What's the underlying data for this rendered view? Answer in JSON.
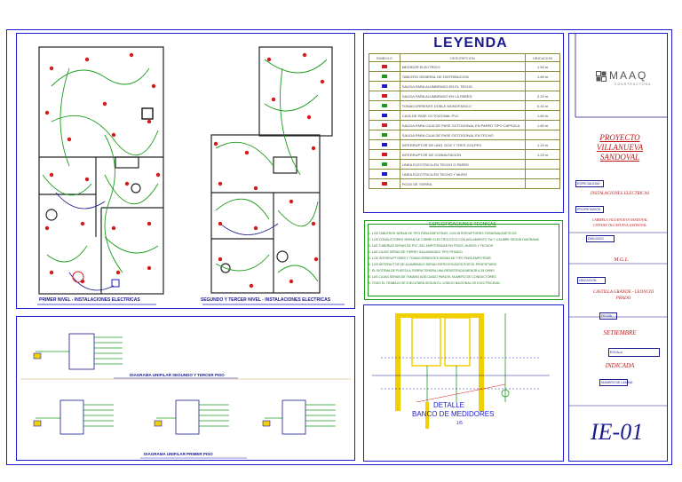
{
  "plans": {
    "first_floor_caption": "PRIMER NIVEL - INSTALACIONES ELECTRICAS",
    "upper_floors_caption": "SEGUNDO Y TERCER NIVEL - INSTALACIONES ELECTRICAS"
  },
  "diagrams": {
    "upper_caption": "DIAGRAMA UNIFILAR SEGUNDO Y TERCER PISO",
    "first_caption": "DIAGRAMA UNIFILAR PRIMER PISO"
  },
  "legend": {
    "title": "LEYENDA",
    "headers": [
      "SIMBOLO",
      "DESCRIPCION",
      "UBICACION"
    ],
    "rows": [
      {
        "desc": "MEDIDOR ELECTRICO",
        "loc": "1.50 m"
      },
      {
        "desc": "TABLERO GENERAL DE DISTRIBUCION",
        "loc": "1.80 m"
      },
      {
        "desc": "SALIDA PARA ALUMBRADO EN EL TECHO",
        "loc": ""
      },
      {
        "desc": "SALIDA PARA ALUMBRADO EN LA PARED",
        "loc": "2.20 m"
      },
      {
        "desc": "TOMACORRIENTE DOBLE MONOFASICO",
        "loc": "0.40 m"
      },
      {
        "desc": "CAJA DE PASE OCTOGONAL PVC",
        "loc": "1.80 m"
      },
      {
        "desc": "SALIDA PARA CAJA DE PASE OCTOGONAL EN PARED TIPO CAPSULA",
        "loc": "1.80 m"
      },
      {
        "desc": "SALIDA PARA CAJA DE PASE OCTOGONAL EN TECHO",
        "loc": ""
      },
      {
        "desc": "INTERRUPTOR DE UNO, DOS Y TRES GOLPES",
        "loc": "1.20 m"
      },
      {
        "desc": "INTERRUPTOR DE CONMUTACION",
        "loc": "1.20 m"
      },
      {
        "desc": "LINEA ELECTRICA EN TECHO O PARED",
        "loc": ""
      },
      {
        "desc": "LINEA ELECTRICA EN TECHO Y MURO",
        "loc": ""
      },
      {
        "desc": "POZO DE TIERRA",
        "loc": ""
      }
    ]
  },
  "specs": {
    "title": "ESPECIFICACIONES TECNICAS",
    "lines": [
      "1. LOS TABLEROS SERAN DE TIPO PARA EMPOTRAR, CON INTERRUPTORES TERMOMAGNETICOS",
      "2. LOS CONDUCTORES SERAN DE COBRE ELECTROLITICO CON AISLAMIENTO TW Y CALIBRE SEGUN DIAGRAMA",
      "3. LAS TUBERIAS SERAN DE PVC-SEL EMPOTRADAS EN PISOS, MUROS Y TECHOS",
      "4. LAS CAJAS SERAN DE FIERRO GALVANIZADO TIPO PESADO",
      "5. LOS INTERRUPTORES Y TOMACORRIENTES SERAN DE TIPO PARA EMPOTRAR",
      "6. LOS ARTEFACTOS DE ALUMBRADO SERAN ESPECIFICADOS POR EL PROPIETARIO",
      "7. EL SISTEMA DE PUESTA A TIERRA TENDRA UNA RESISTENCIA MENOR A 25 OHMS",
      "8. LAS CAJAS SERAN DE TAMANO ADECUADO PARA EL NUMERO DE CONDUCTORES",
      "9. TODO EL TRABAJO SE EJECUTARA SEGUN EL CODIGO NACIONAL DE ELECTRICIDAD"
    ]
  },
  "detail": {
    "title": "DETALLE",
    "subtitle": "BANCO DE MEDIDORES",
    "scale": "1/5"
  },
  "title_block": {
    "company": "MAAQ",
    "company_sub": "CONSTRUCTORA",
    "project_heading": "PROYECTO",
    "project_name_1": "VILLANUEVA",
    "project_name_2": "SANDOVAL",
    "specialty": "INSTALACIONES ELECTRICAS",
    "owner_1": "CARMELA VILLANUEVA SANDOVAL",
    "owner_2": "CINTHIA VILLANUEVA SANDOVAL",
    "location": "CASTILLA GRANDE - LEONCIO PRADO",
    "date": "SETIEMBRE",
    "scale": "INDICADA",
    "sheet": "IE-01",
    "tags": {
      "specialty": "ESPECIALIDAD",
      "owners": "PROPIETARIOS",
      "drew": "DIBUJADO",
      "location": "UBICACION",
      "date": "FECHA",
      "scale": "ESCALA",
      "sheet": "NUMERO DE LAMINA"
    }
  },
  "colors": {
    "frame": "#1a1acc",
    "wall": "#222222",
    "circuit": "#1a9c1a",
    "outlet": "#d41a1a",
    "trace": "#1a1a8c",
    "accent": "#f0d000"
  }
}
